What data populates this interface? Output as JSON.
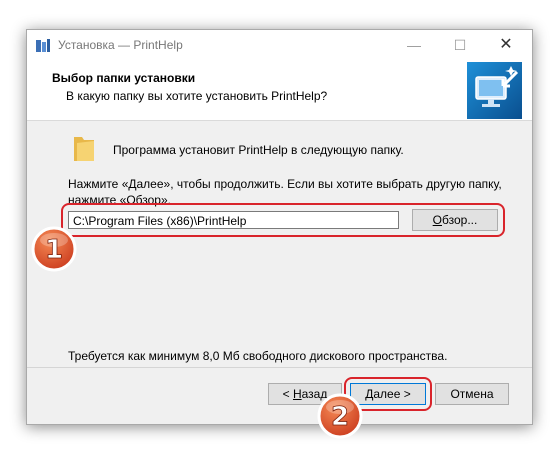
{
  "window": {
    "title": "Установка — PrintHelp",
    "minimize_glyph": "—",
    "maximize_glyph": "☐",
    "close_glyph": "✕"
  },
  "header": {
    "title": "Выбор папки установки",
    "subtitle": "В какую папку вы хотите установить PrintHelp?"
  },
  "body": {
    "install_text": "Программа установит PrintHelp в следующую папку.",
    "instruction_line1": "Нажмите «Далее», чтобы продолжить. Если вы хотите выбрать другую папку,",
    "instruction_line2": "нажмите «Обзор».",
    "path_value": "C:\\Program Files (x86)\\PrintHelp",
    "browse_label_access": "О",
    "browse_label_rest": "бзор...",
    "space_text": "Требуется как минимум 8,0 Мб свободного дискового пространства."
  },
  "buttons": {
    "back_prefix": "< ",
    "back_access": "Н",
    "back_rest": "азад",
    "next_access": "Д",
    "next_rest": "алее >",
    "cancel": "Отмена"
  },
  "badges": {
    "first": "1",
    "second": "2"
  },
  "colors": {
    "highlight": "#d9242b",
    "badge": "#d8401f",
    "accent": "#0078d7"
  }
}
